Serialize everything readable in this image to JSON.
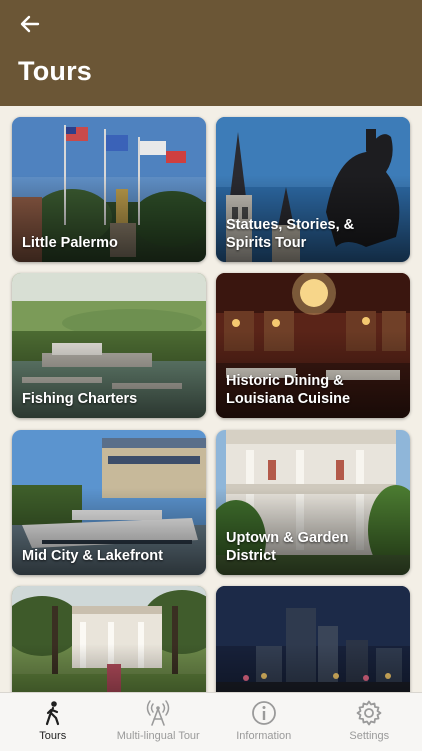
{
  "header": {
    "title": "Tours",
    "back_icon": "back-arrow-icon"
  },
  "tours": [
    {
      "label": "Little Palermo"
    },
    {
      "label": "Statues, Stories, & Spirits Tour"
    },
    {
      "label": "Fishing Charters"
    },
    {
      "label": "Historic Dining & Louisiana Cuisine"
    },
    {
      "label": "Mid City & Lakefront"
    },
    {
      "label": "Uptown & Garden District"
    },
    {
      "label": ""
    },
    {
      "label": ""
    }
  ],
  "tabbar": {
    "tabs": [
      {
        "label": "Tours",
        "icon": "walking-person-icon",
        "active": true
      },
      {
        "label": "Multi-lingual Tour",
        "icon": "broadcast-tower-icon",
        "active": false
      },
      {
        "label": "Information",
        "icon": "info-icon",
        "active": false
      },
      {
        "label": "Settings",
        "icon": "gear-icon",
        "active": false
      }
    ]
  },
  "colors": {
    "header_bg": "#6b5636",
    "page_bg": "#f3efe6",
    "tab_active": "#1f1f1f",
    "tab_inactive": "#9a9a9a"
  }
}
